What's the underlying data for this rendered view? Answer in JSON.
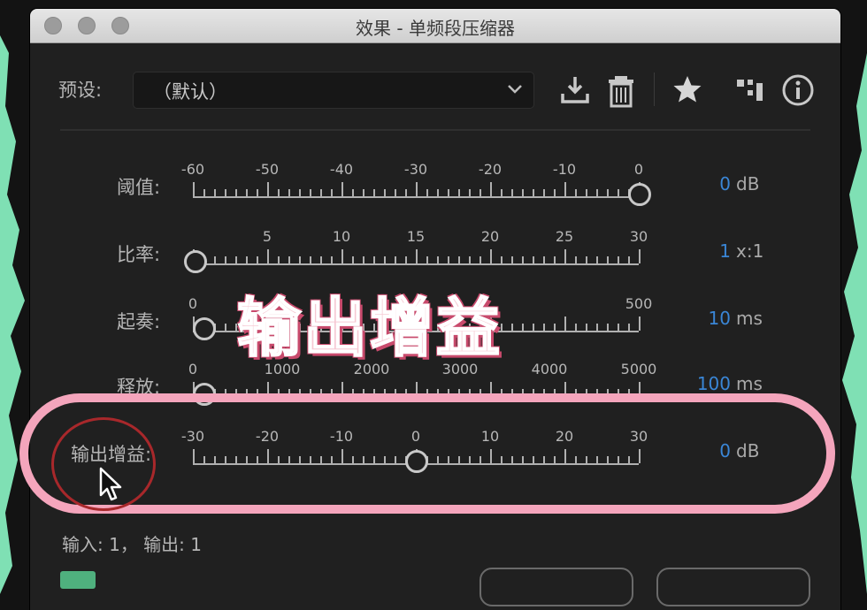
{
  "window": {
    "title": "效果 - 单频段压缩器"
  },
  "preset": {
    "label": "预设:",
    "value": "（默认）"
  },
  "toolbar": [
    {
      "icon": "download-icon"
    },
    {
      "icon": "trash-icon"
    },
    {
      "icon": "star-icon"
    },
    {
      "icon": "routing-icon"
    },
    {
      "icon": "info-icon"
    }
  ],
  "params": [
    {
      "label": "阈值:",
      "ticks": [
        "-60",
        "-50",
        "-40",
        "-30",
        "-20",
        "-10",
        "0"
      ],
      "value": "0",
      "unit": "dB",
      "fraction": 1.0
    },
    {
      "label": "比率:",
      "ticks": [
        "",
        "5",
        "10",
        "15",
        "20",
        "25",
        "30"
      ],
      "value": "1",
      "unit": "x:1",
      "fraction": 0.0
    },
    {
      "label": "起奏:",
      "ticks": [
        "0",
        "",
        "",
        "",
        "",
        "",
        "500"
      ],
      "value": "10",
      "unit": "ms",
      "fraction": 0.02
    },
    {
      "label": "释放:",
      "ticks": [
        "0",
        "1000",
        "2000",
        "3000",
        "4000",
        "5000"
      ],
      "value": "100",
      "unit": "ms",
      "fraction": 0.02
    },
    {
      "label": "输出增益:",
      "ticks": [
        "-30",
        "-20",
        "-10",
        "0",
        "10",
        "20",
        "30"
      ],
      "value": "0",
      "unit": "dB",
      "fraction": 0.5
    }
  ],
  "status": "输入: 1， 输出: 1",
  "overlay_caption": "输出增益",
  "colors": {
    "accent": "#3a86d6",
    "highlight": "#f4a5bc",
    "waveform": "#7fe0b4"
  }
}
